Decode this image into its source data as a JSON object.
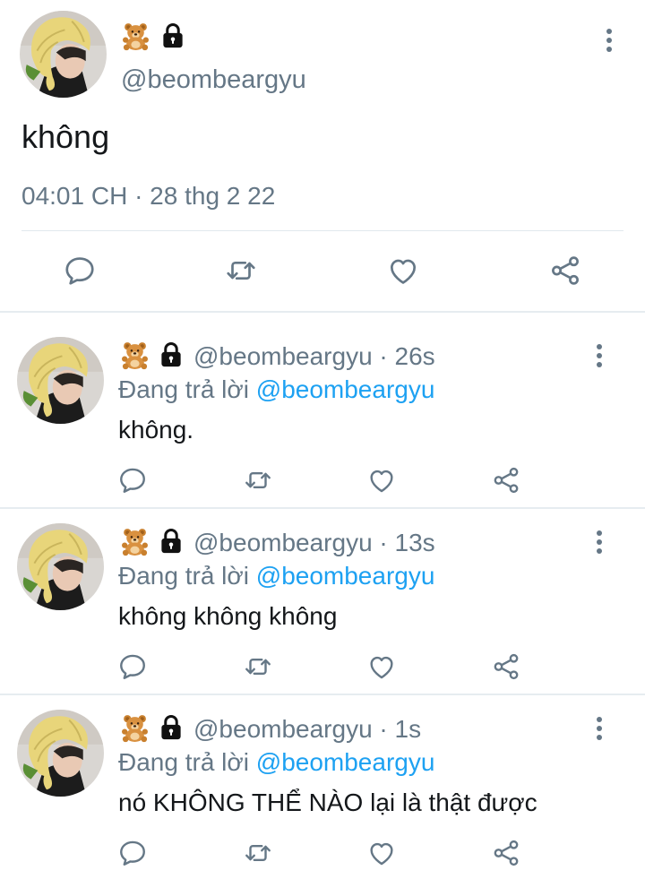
{
  "main_tweet": {
    "handle": "@beombeargyu",
    "text": "không",
    "timestamp": "04:01 CH · 28 thg 2 22",
    "badge_icons": [
      "bear-emoji",
      "lock-icon"
    ]
  },
  "replies": [
    {
      "handle_time": "@beombeargyu · 26s",
      "replying_label": "Đang trả lời",
      "replying_to": "@beombeargyu",
      "text": "không."
    },
    {
      "handle_time": "@beombeargyu · 13s",
      "replying_label": "Đang trả lời",
      "replying_to": "@beombeargyu",
      "text": "không không không"
    },
    {
      "handle_time": "@beombeargyu · 1s",
      "replying_label": "Đang trả lời",
      "replying_to": "@beombeargyu",
      "text": "nó KHÔNG THỂ NÀO lại là thật được"
    }
  ],
  "action_icons": [
    "reply-icon",
    "retweet-icon",
    "like-icon",
    "share-icon"
  ],
  "colors": {
    "text": "#14171a",
    "secondary": "#657786",
    "link": "#1da1f2",
    "divider": "#e6ecf0"
  }
}
